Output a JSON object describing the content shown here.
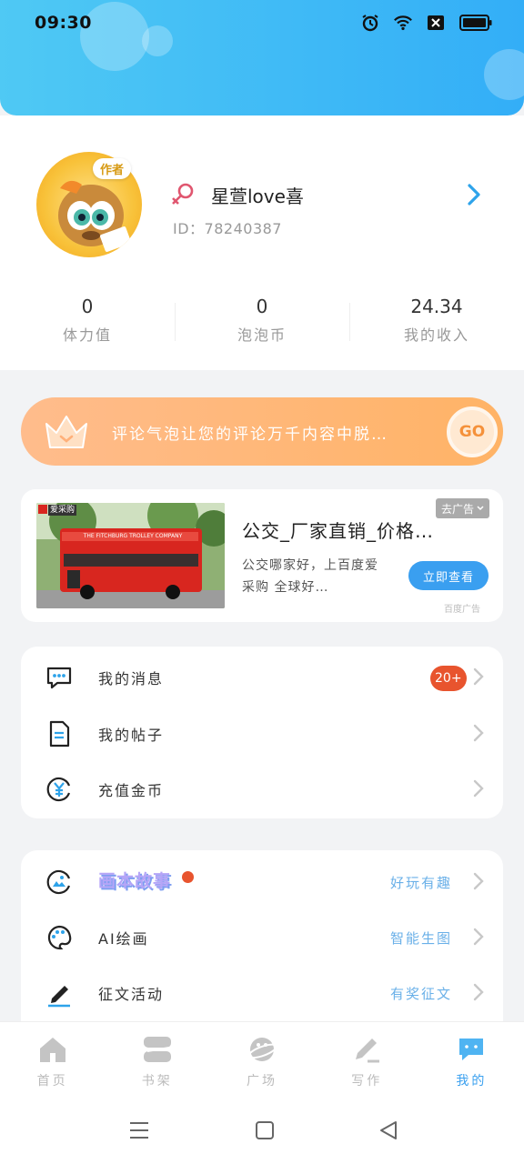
{
  "status_bar": {
    "time": "09:30",
    "icons": [
      "alarm-icon",
      "wifi-icon",
      "sim-icon",
      "battery-icon"
    ]
  },
  "profile": {
    "author_tag": "作者",
    "nickname": "星萱love喜",
    "id_text": "ID：78240387",
    "stats": [
      {
        "value": "0",
        "label": "体力值"
      },
      {
        "value": "0",
        "label": "泡泡币"
      },
      {
        "value": "24.34",
        "label": "我的收入"
      }
    ]
  },
  "promo": {
    "text": "评论气泡让您的评论万千内容中脱…",
    "go_label": "GO"
  },
  "ad": {
    "title": "公交_厂家直销_价格…",
    "description": "公交哪家好，上百度爱采购 全球好…",
    "close_label": "去广告",
    "button_label": "立即查看",
    "source": "百度广告",
    "image_brand": "爱采购",
    "image_banner": "THE FITCHBURG TROLLEY COMPANY"
  },
  "menu_primary": [
    {
      "label": "我的消息",
      "icon": "message-icon",
      "badge": "20+"
    },
    {
      "label": "我的帖子",
      "icon": "document-icon"
    },
    {
      "label": "充值金币",
      "icon": "yuan-coin-icon"
    }
  ],
  "menu_secondary": [
    {
      "label": "画本故事",
      "icon": "picture-book-icon",
      "extra": "好玩有趣"
    },
    {
      "label": "AI绘画",
      "icon": "palette-icon",
      "extra": "智能生图"
    },
    {
      "label": "征文活动",
      "icon": "pen-icon",
      "extra": "有奖征文"
    }
  ],
  "bottom_nav": [
    {
      "label": "首页",
      "icon": "home-icon"
    },
    {
      "label": "书架",
      "icon": "bookshelf-icon"
    },
    {
      "label": "广场",
      "icon": "planet-icon"
    },
    {
      "label": "写作",
      "icon": "write-icon"
    },
    {
      "label": "我的",
      "icon": "me-icon",
      "active": true
    }
  ],
  "colors": {
    "header_start": "#4fc9f4",
    "header_end": "#33aef7",
    "accent": "#3aa0ef",
    "badge": "#e8542e",
    "promo": "#ffb880"
  }
}
